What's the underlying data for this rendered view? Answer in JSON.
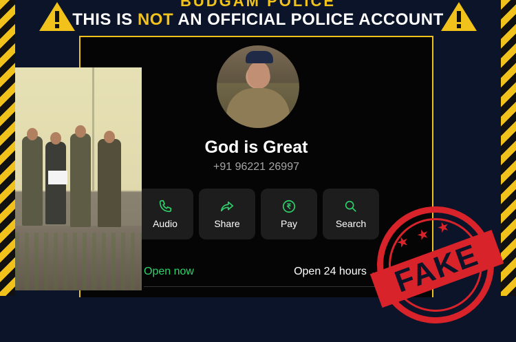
{
  "header": {
    "brand_partial": "BUDGAM POLICE",
    "warning_prefix": "THIS IS ",
    "warning_highlight": "NOT",
    "warning_suffix": " AN OFFICIAL POLICE ACCOUNT"
  },
  "profile": {
    "name": "God is Great",
    "phone": "+91 96221 26997"
  },
  "actions": [
    {
      "label": "Audio",
      "icon": "phone-icon"
    },
    {
      "label": "Share",
      "icon": "share-arrow-icon"
    },
    {
      "label": "Pay",
      "icon": "rupee-icon"
    },
    {
      "label": "Search",
      "icon": "search-icon"
    }
  ],
  "business_hours": {
    "status": "Open now",
    "hours": "Open 24 hours"
  },
  "stamp": {
    "stars": "★ ★ ★",
    "text": "FAKE"
  },
  "colors": {
    "accent_yellow": "#f1c21b",
    "action_green": "#2ed36b",
    "stamp_red": "#d8232a",
    "background": "#0b1428"
  }
}
